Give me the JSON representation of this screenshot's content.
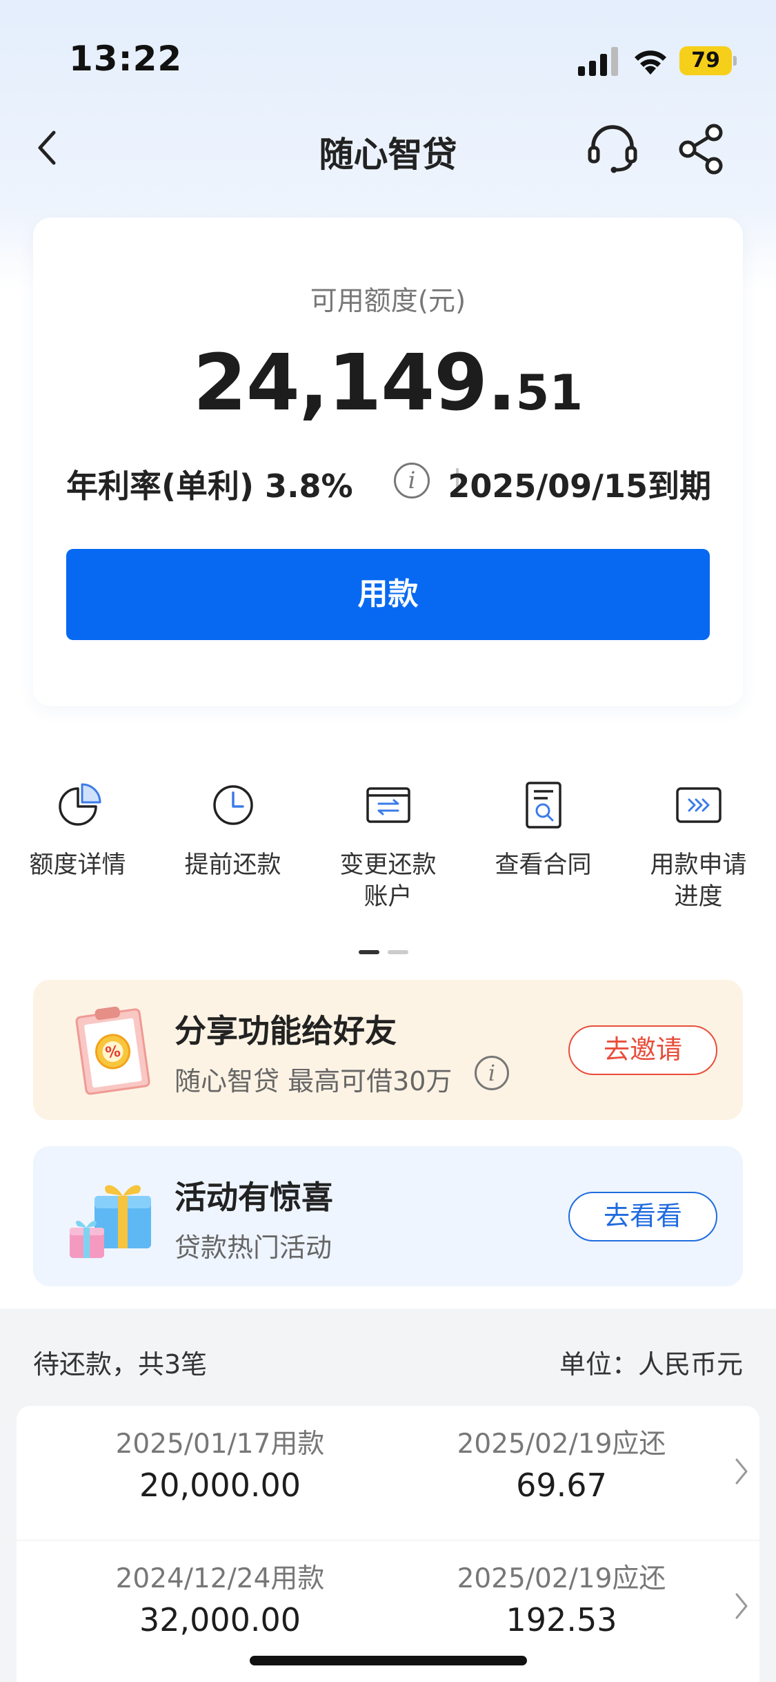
{
  "status_bar": {
    "time": "13:22",
    "battery": "79"
  },
  "nav": {
    "title": "随心智贷"
  },
  "credit": {
    "label": "可用额度(元)",
    "amount_integer": "24,149.",
    "amount_decimal": "51",
    "rate": "年利率(单利) 3.8%",
    "due": "2025/09/15到期",
    "borrow_button": "用款"
  },
  "actions": [
    {
      "label": "额度详情",
      "icon": "pie-chart-icon"
    },
    {
      "label": "提前还款",
      "icon": "clock-icon"
    },
    {
      "label": "变更还款\n账户",
      "icon": "card-transfer-icon"
    },
    {
      "label": "查看合同",
      "icon": "document-search-icon"
    },
    {
      "label": "用款申请\n进度",
      "icon": "progress-arrows-icon"
    }
  ],
  "promos": {
    "invite": {
      "title": "分享功能给好友",
      "subtitle": "随心智贷 最高可借30万",
      "button": "去邀请",
      "image": "coupon-clipboard-image"
    },
    "event": {
      "title": "活动有惊喜",
      "subtitle": "贷款热门活动",
      "button": "去看看",
      "image": "gift-box-image"
    }
  },
  "repayment": {
    "count_label": "待还款，共3笔",
    "unit_label": "单位：人民币元",
    "rows": [
      {
        "borrow_date": "2025/01/17用款",
        "borrow_amount": "20,000.00",
        "due_date": "2025/02/19应还",
        "due_amount": "69.67"
      },
      {
        "borrow_date": "2024/12/24用款",
        "borrow_amount": "32,000.00",
        "due_date": "2025/02/19应还",
        "due_amount": "192.53"
      }
    ]
  },
  "colors": {
    "primary": "#0769f2",
    "invite_accent": "#e94d3a",
    "event_accent": "#1f6be0",
    "battery": "#f6cf1a"
  }
}
